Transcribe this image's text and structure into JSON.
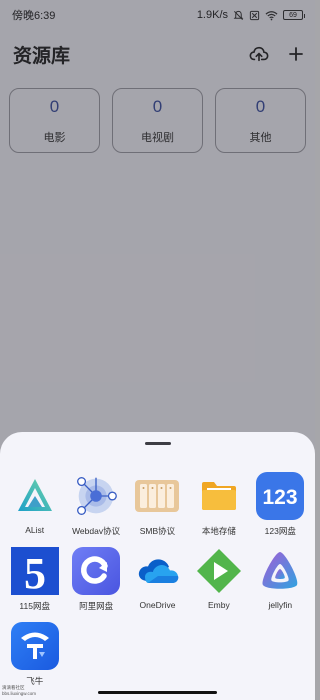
{
  "status_bar": {
    "time": "傍晚6:39",
    "speed": "1.9K/s",
    "battery": "69"
  },
  "header": {
    "title": "资源库"
  },
  "stats": [
    {
      "count": "0",
      "label": "电影"
    },
    {
      "count": "0",
      "label": "电视剧"
    },
    {
      "count": "0",
      "label": "其他"
    }
  ],
  "sheet": {
    "sources": [
      {
        "label": "AList",
        "icon": "alist-icon"
      },
      {
        "label": "Webdav协议",
        "icon": "webdav-icon"
      },
      {
        "label": "SMB协议",
        "icon": "smb-icon"
      },
      {
        "label": "本地存储",
        "icon": "folder-icon"
      },
      {
        "label": "123网盘",
        "icon": "pan123-icon"
      },
      {
        "label": "115网盘",
        "icon": "pan115-icon"
      },
      {
        "label": "阿里网盘",
        "icon": "aliyun-icon"
      },
      {
        "label": "OneDrive",
        "icon": "onedrive-icon"
      },
      {
        "label": "Emby",
        "icon": "emby-icon"
      },
      {
        "label": "jellyfin",
        "icon": "jellyfin-icon"
      },
      {
        "label": "飞牛",
        "icon": "feiniu-icon"
      }
    ],
    "icon_text": {
      "pan123": "123",
      "pan115": "5"
    }
  },
  "watermark": {
    "line1": "滴滴看社区",
    "line2": "bbs.liuxingw.com"
  },
  "colors": {
    "accent": "#3a4ea0",
    "sheet_bg": "#f4f4fa",
    "scrim": "rgba(40,40,48,0.38)"
  }
}
